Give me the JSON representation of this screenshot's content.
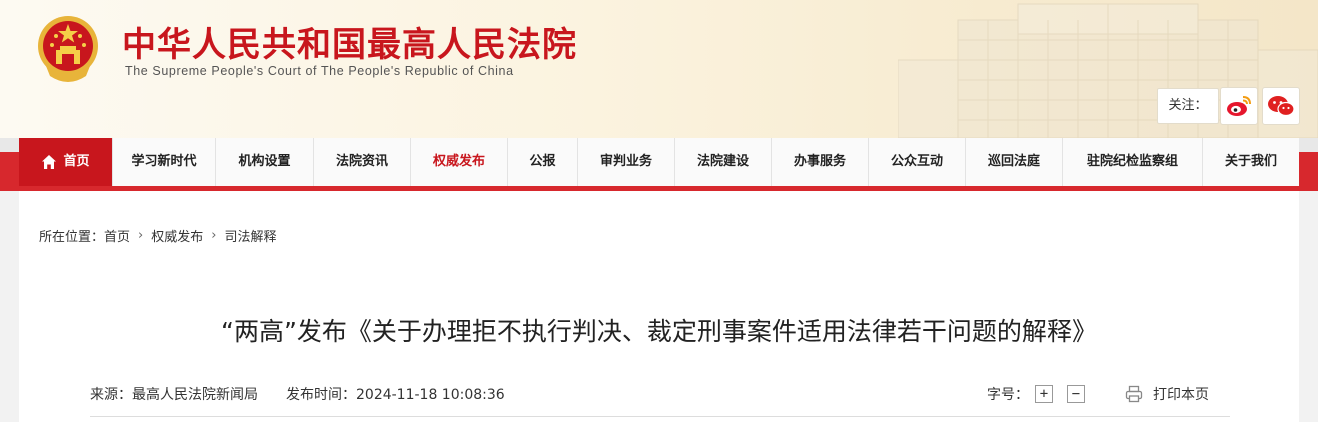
{
  "header": {
    "title": "中华人民共和国最高人民法院",
    "subtitle": "The Supreme People's Court of The People's Republic of China",
    "follow_label": "关注：",
    "social": [
      {
        "name": "weibo-icon",
        "color": "#e6162d"
      },
      {
        "name": "wechat-icon",
        "color": "#e02020"
      }
    ]
  },
  "nav": {
    "items": [
      {
        "label": "首页",
        "icon": "home-icon"
      },
      {
        "label": "学习新时代"
      },
      {
        "label": "机构设置"
      },
      {
        "label": "法院资讯"
      },
      {
        "label": "权威发布",
        "active": true
      },
      {
        "label": "公报"
      },
      {
        "label": "审判业务"
      },
      {
        "label": "法院建设"
      },
      {
        "label": "办事服务"
      },
      {
        "label": "公众互动"
      },
      {
        "label": "巡回法庭"
      },
      {
        "label": "驻院纪检监察组"
      },
      {
        "label": "关于我们"
      }
    ]
  },
  "breadcrumb": {
    "prefix": "所在位置：",
    "items": [
      "首页",
      "权威发布",
      "司法解释"
    ]
  },
  "article": {
    "title": "“两高”发布《关于办理拒不执行判决、裁定刑事案件适用法律若干问题的解释》",
    "source": "来源：最高人民法院新闻局",
    "published": "发布时间：2024-11-18 10:08:36",
    "font_size_label": "字号：",
    "zoom_in": "+",
    "zoom_out": "−",
    "print_label": "打印本页"
  },
  "colors": {
    "brand_red": "#c8161d",
    "nav_bar_red": "#d7282d"
  }
}
